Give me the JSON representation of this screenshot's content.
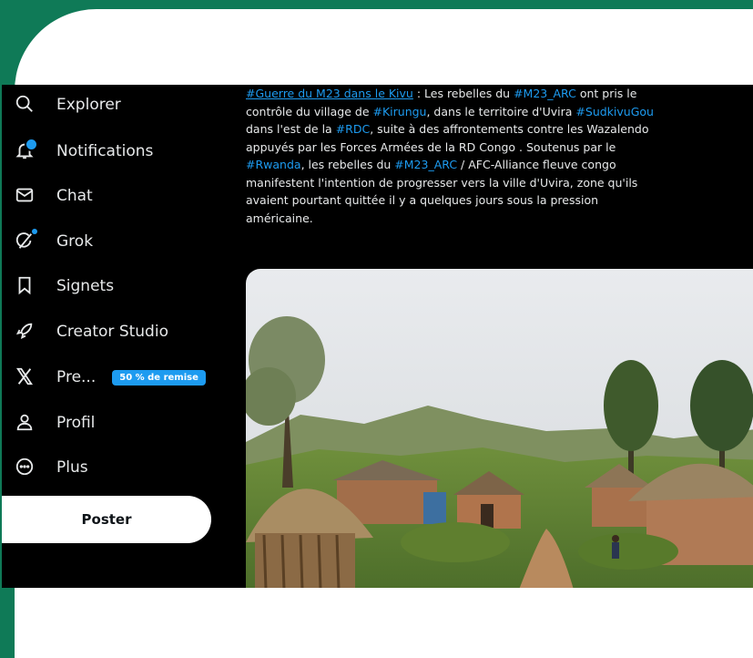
{
  "sidebar": {
    "items": [
      {
        "label": "Explorer",
        "icon": "search-icon"
      },
      {
        "label": "Notifications",
        "icon": "bell-icon"
      },
      {
        "label": "Chat",
        "icon": "mail-icon"
      },
      {
        "label": "Grok",
        "icon": "grok-icon"
      },
      {
        "label": "Signets",
        "icon": "bookmark-icon"
      },
      {
        "label": "Creator Studio",
        "icon": "rocket-icon"
      },
      {
        "label": "Pre...",
        "icon": "x-logo-icon",
        "badge": "50 % de remise"
      },
      {
        "label": "Profil",
        "icon": "person-icon"
      },
      {
        "label": "Plus",
        "icon": "more-circle-icon"
      }
    ],
    "post_label": "Poster"
  },
  "tweet": {
    "tags": {
      "t1": "#Guerre du M23 dans le Kivu",
      "t2": "#M23_ARC",
      "t3": "#Kirungu",
      "t4": "#SudkivuGou",
      "t5": "#RDC",
      "t6": "#Rwanda",
      "t7": "#M23_ARC"
    },
    "texts": {
      "s1": " : Les rebelles du ",
      "s2": " ont pris le",
      "s3": "contrôle du village de ",
      "s4": ", dans le territoire d'Uvira ",
      "s5": "dans l'est de la ",
      "s6": ", suite à des affrontements contre les Wazalendo",
      "s7": "appuyés par les Forces Armées de la RD Congo . Soutenus par le",
      "s8": ", les rebelles du ",
      "s9": " / AFC-Alliance fleuve congo",
      "s10": "manifestent l'intention de progresser vers la ville d'Uvira, zone qu'ils",
      "s11": "avaient pourtant quittée il y a quelques jours sous la pression",
      "s12": "américaine."
    }
  },
  "colors": {
    "background_green": "#0f7a57",
    "accent_blue": "#1d9bf0",
    "text": "#e7e9ea"
  }
}
